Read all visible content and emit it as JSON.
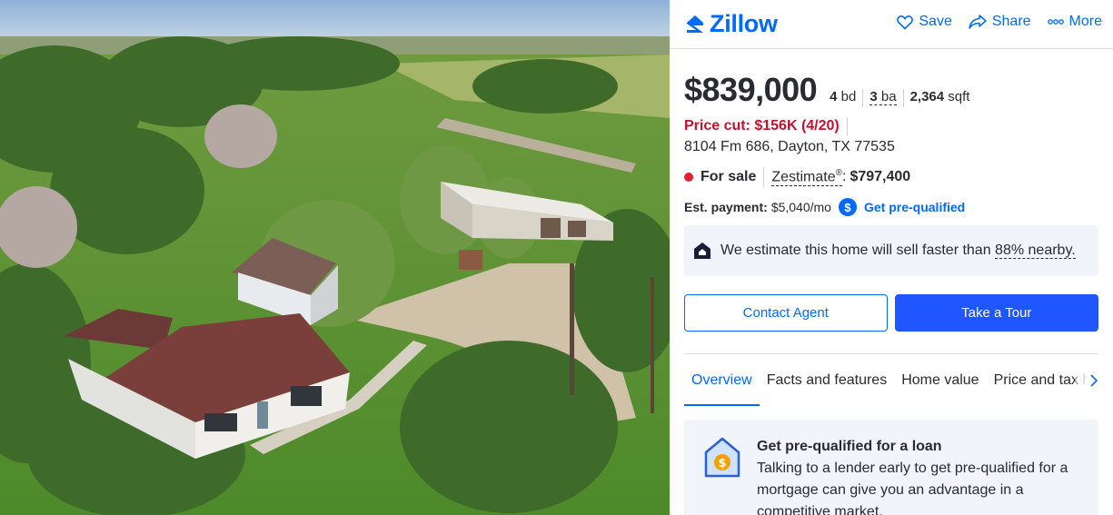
{
  "brand": {
    "name": "Zillow",
    "color": "#006aff",
    "logo_icon": "zillow-z-icon"
  },
  "top_actions": [
    {
      "label": "Save",
      "icon": "heart-icon"
    },
    {
      "label": "Share",
      "icon": "share-icon"
    },
    {
      "label": "More",
      "icon": "more-dots-icon"
    }
  ],
  "listing": {
    "price": "$839,000",
    "beds_value": "4",
    "beds_unit": "bd",
    "baths_value": "3",
    "baths_unit": "ba",
    "sqft_value": "2,364",
    "sqft_unit": "sqft",
    "price_cut": "Price cut: $156K (4/20)",
    "address": "8104 Fm 686, Dayton, TX 77535",
    "status": "For sale",
    "zestimate_label": "Zestimate",
    "zestimate_sup": "®",
    "zestimate_value": "$797,400",
    "payment_label": "Est. payment:",
    "payment_value": "$5,040/mo",
    "prequal_link": "Get pre-qualified"
  },
  "estimate_banner": {
    "text_before": "We estimate this home will sell faster than ",
    "text_link": "88% nearby."
  },
  "buttons": {
    "contact": "Contact Agent",
    "tour": "Take a Tour"
  },
  "tabs": [
    "Overview",
    "Facts and features",
    "Home value",
    "Price and tax history"
  ],
  "active_tab": "Overview",
  "loan_card": {
    "title": "Get pre-qualified for a loan",
    "body": "Talking to a lender early to get pre-qualified for a mortgage can give you an advantage in a competitive market."
  },
  "colors": {
    "accent": "#006aff",
    "price_cut": "#c8102e",
    "status_dot": "#e5202f",
    "tour_button": "#1f56ff"
  }
}
